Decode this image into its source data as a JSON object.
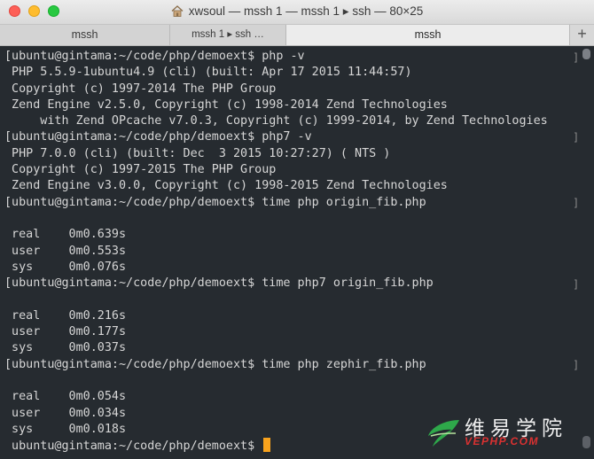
{
  "window": {
    "title": "xwsoul — mssh 1 — mssh 1 ▸ ssh — 80×25"
  },
  "tabs": [
    {
      "label": "mssh"
    },
    {
      "label": "mssh 1 ▸ ssh …"
    },
    {
      "label": "mssh"
    }
  ],
  "new_tab_label": "+",
  "terminal": {
    "lines": [
      "[ubuntu@gintama:~/code/php/demoext$ php -v",
      " PHP 5.5.9-1ubuntu4.9 (cli) (built: Apr 17 2015 11:44:57)",
      " Copyright (c) 1997-2014 The PHP Group",
      " Zend Engine v2.5.0, Copyright (c) 1998-2014 Zend Technologies",
      "     with Zend OPcache v7.0.3, Copyright (c) 1999-2014, by Zend Technologies",
      "[ubuntu@gintama:~/code/php/demoext$ php7 -v",
      " PHP 7.0.0 (cli) (built: Dec  3 2015 10:27:27) ( NTS )",
      " Copyright (c) 1997-2015 The PHP Group",
      " Zend Engine v3.0.0, Copyright (c) 1998-2015 Zend Technologies",
      "[ubuntu@gintama:~/code/php/demoext$ time php origin_fib.php",
      "",
      " real    0m0.639s",
      " user    0m0.553s",
      " sys     0m0.076s",
      "[ubuntu@gintama:~/code/php/demoext$ time php7 origin_fib.php",
      "",
      " real    0m0.216s",
      " user    0m0.177s",
      " sys     0m0.037s",
      "[ubuntu@gintama:~/code/php/demoext$ time php zephir_fib.php",
      "",
      " real    0m0.054s",
      " user    0m0.034s",
      " sys     0m0.018s",
      " ubuntu@gintama:~/code/php/demoext$ "
    ]
  },
  "watermark": {
    "chinese": "维易学院",
    "english": "VEPHP.COM"
  },
  "colors": {
    "terminal_bg": "#262b30",
    "terminal_fg": "#d6d6d6",
    "cursor": "#f7a21d"
  }
}
